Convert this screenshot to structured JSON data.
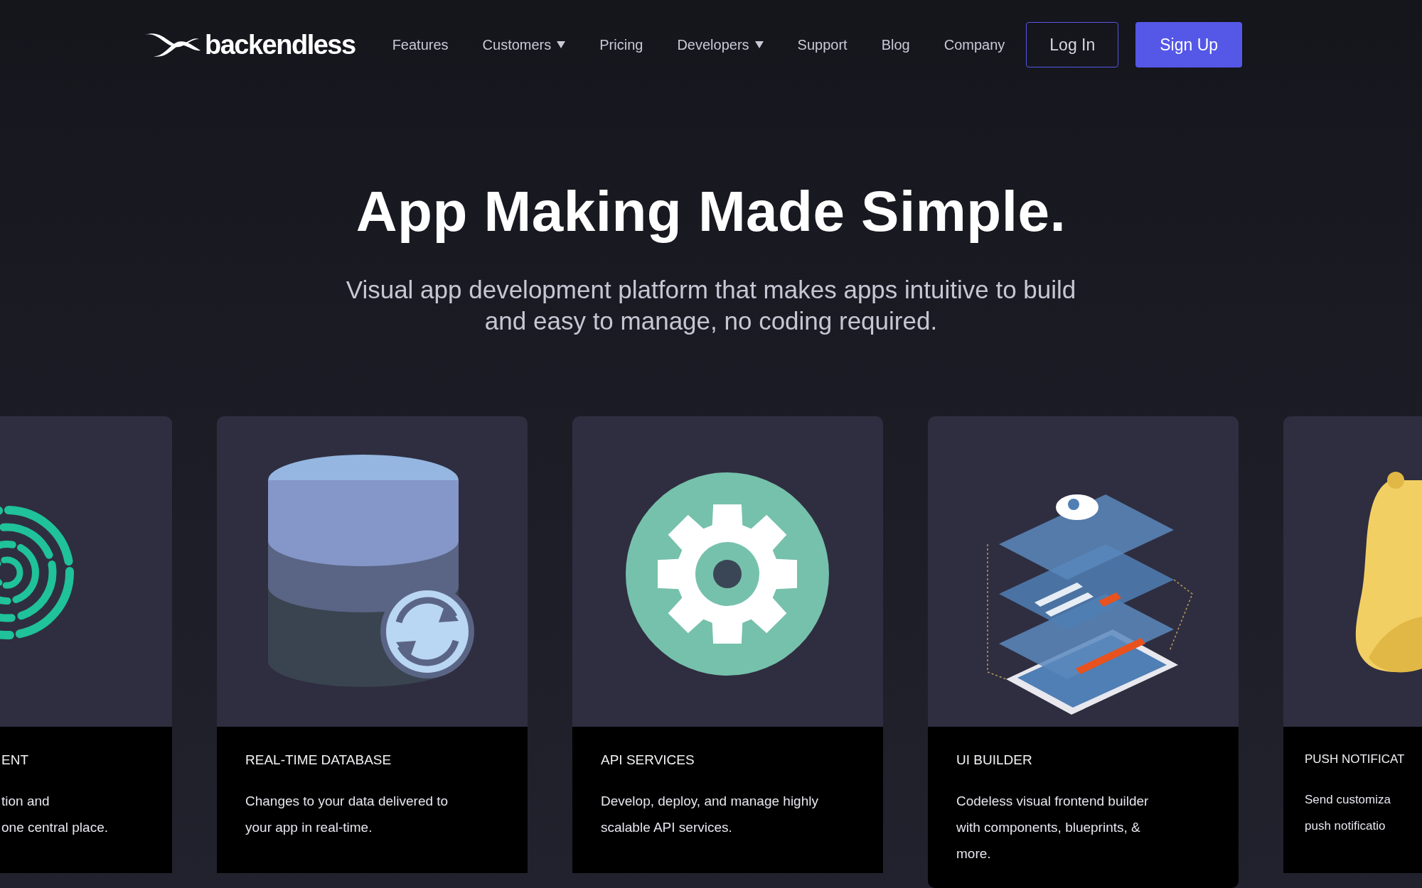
{
  "brand": {
    "name": "backendless"
  },
  "nav": [
    {
      "label": "Features",
      "dropdown": false
    },
    {
      "label": "Customers",
      "dropdown": true
    },
    {
      "label": "Pricing",
      "dropdown": false
    },
    {
      "label": "Developers",
      "dropdown": true
    },
    {
      "label": "Support",
      "dropdown": false
    },
    {
      "label": "Blog",
      "dropdown": false
    },
    {
      "label": "Company",
      "dropdown": false
    }
  ],
  "buttons": [
    {
      "label": "Log In",
      "kind": "outline"
    },
    {
      "label": "Sign Up",
      "kind": "filled"
    }
  ],
  "hero": {
    "title": "App Making Made Simple.",
    "subtitle": "Visual app development platform that makes apps intuitive to build and easy to manage, no coding required."
  },
  "cards": [
    {
      "kind": "rings",
      "title": "ENT",
      "lines": [
        "tion and",
        "one central place."
      ]
    },
    {
      "kind": "database",
      "title": "REAL-TIME DATABASE",
      "lines": [
        "Changes to your data delivered to",
        "your app in real-time."
      ]
    },
    {
      "kind": "gear",
      "title": "API SERVICES",
      "lines": [
        "Develop, deploy, and manage highly",
        "scalable API services."
      ]
    },
    {
      "kind": "screens",
      "title": "UI BUILDER",
      "lines": [
        "Codeless visual frontend builder",
        "with components, blueprints, &",
        "more."
      ]
    },
    {
      "kind": "bell",
      "title": "PUSH NOTIFICAT",
      "lines": [
        "Send customiza",
        "push notificatio"
      ]
    }
  ]
}
